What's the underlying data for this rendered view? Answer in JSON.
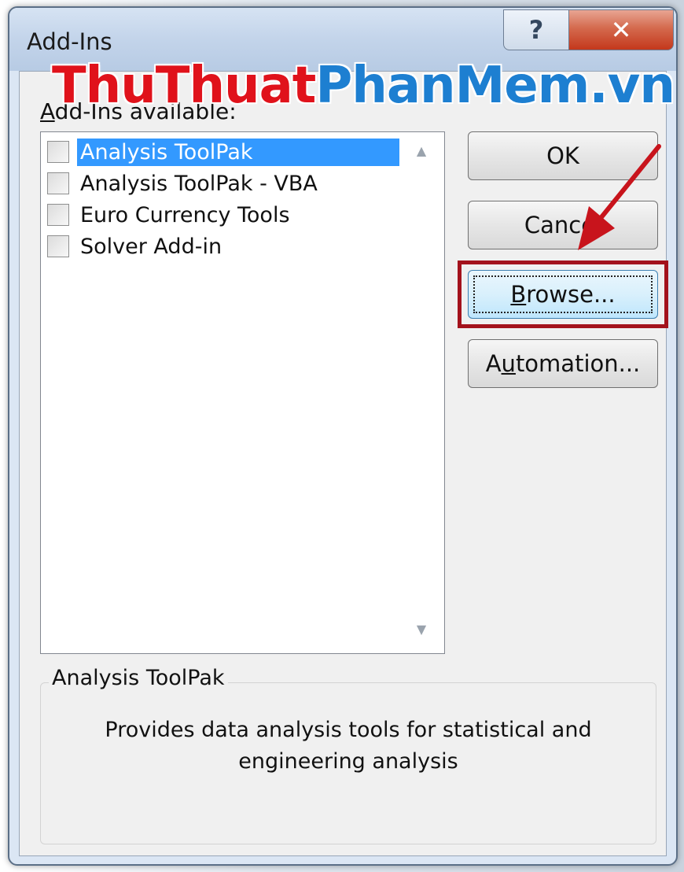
{
  "window": {
    "title": "Add-Ins",
    "help_label": "?",
    "close_label": "✕"
  },
  "list": {
    "label_first_letter": "A",
    "label_rest": "dd-Ins available:",
    "items": [
      {
        "label": "Analysis ToolPak",
        "checked": false,
        "selected": true
      },
      {
        "label": "Analysis ToolPak - VBA",
        "checked": false,
        "selected": false
      },
      {
        "label": "Euro Currency Tools",
        "checked": false,
        "selected": false
      },
      {
        "label": "Solver Add-in",
        "checked": false,
        "selected": false
      }
    ]
  },
  "buttons": {
    "ok": "OK",
    "cancel": "Cancel",
    "browse_mnemonic": "B",
    "browse_rest": "rowse...",
    "automation_pre": "A",
    "automation_mnemonic": "u",
    "automation_rest": "tomation..."
  },
  "description": {
    "title": "Analysis ToolPak",
    "text": "Provides data analysis tools for statistical and engineering analysis"
  },
  "watermark": {
    "part1": "ThuThuat",
    "part2": "PhanMem",
    "part3": ".vn"
  },
  "colors": {
    "selection": "#3399ff",
    "highlight_box": "#a3121c",
    "arrow": "#c8141c"
  }
}
